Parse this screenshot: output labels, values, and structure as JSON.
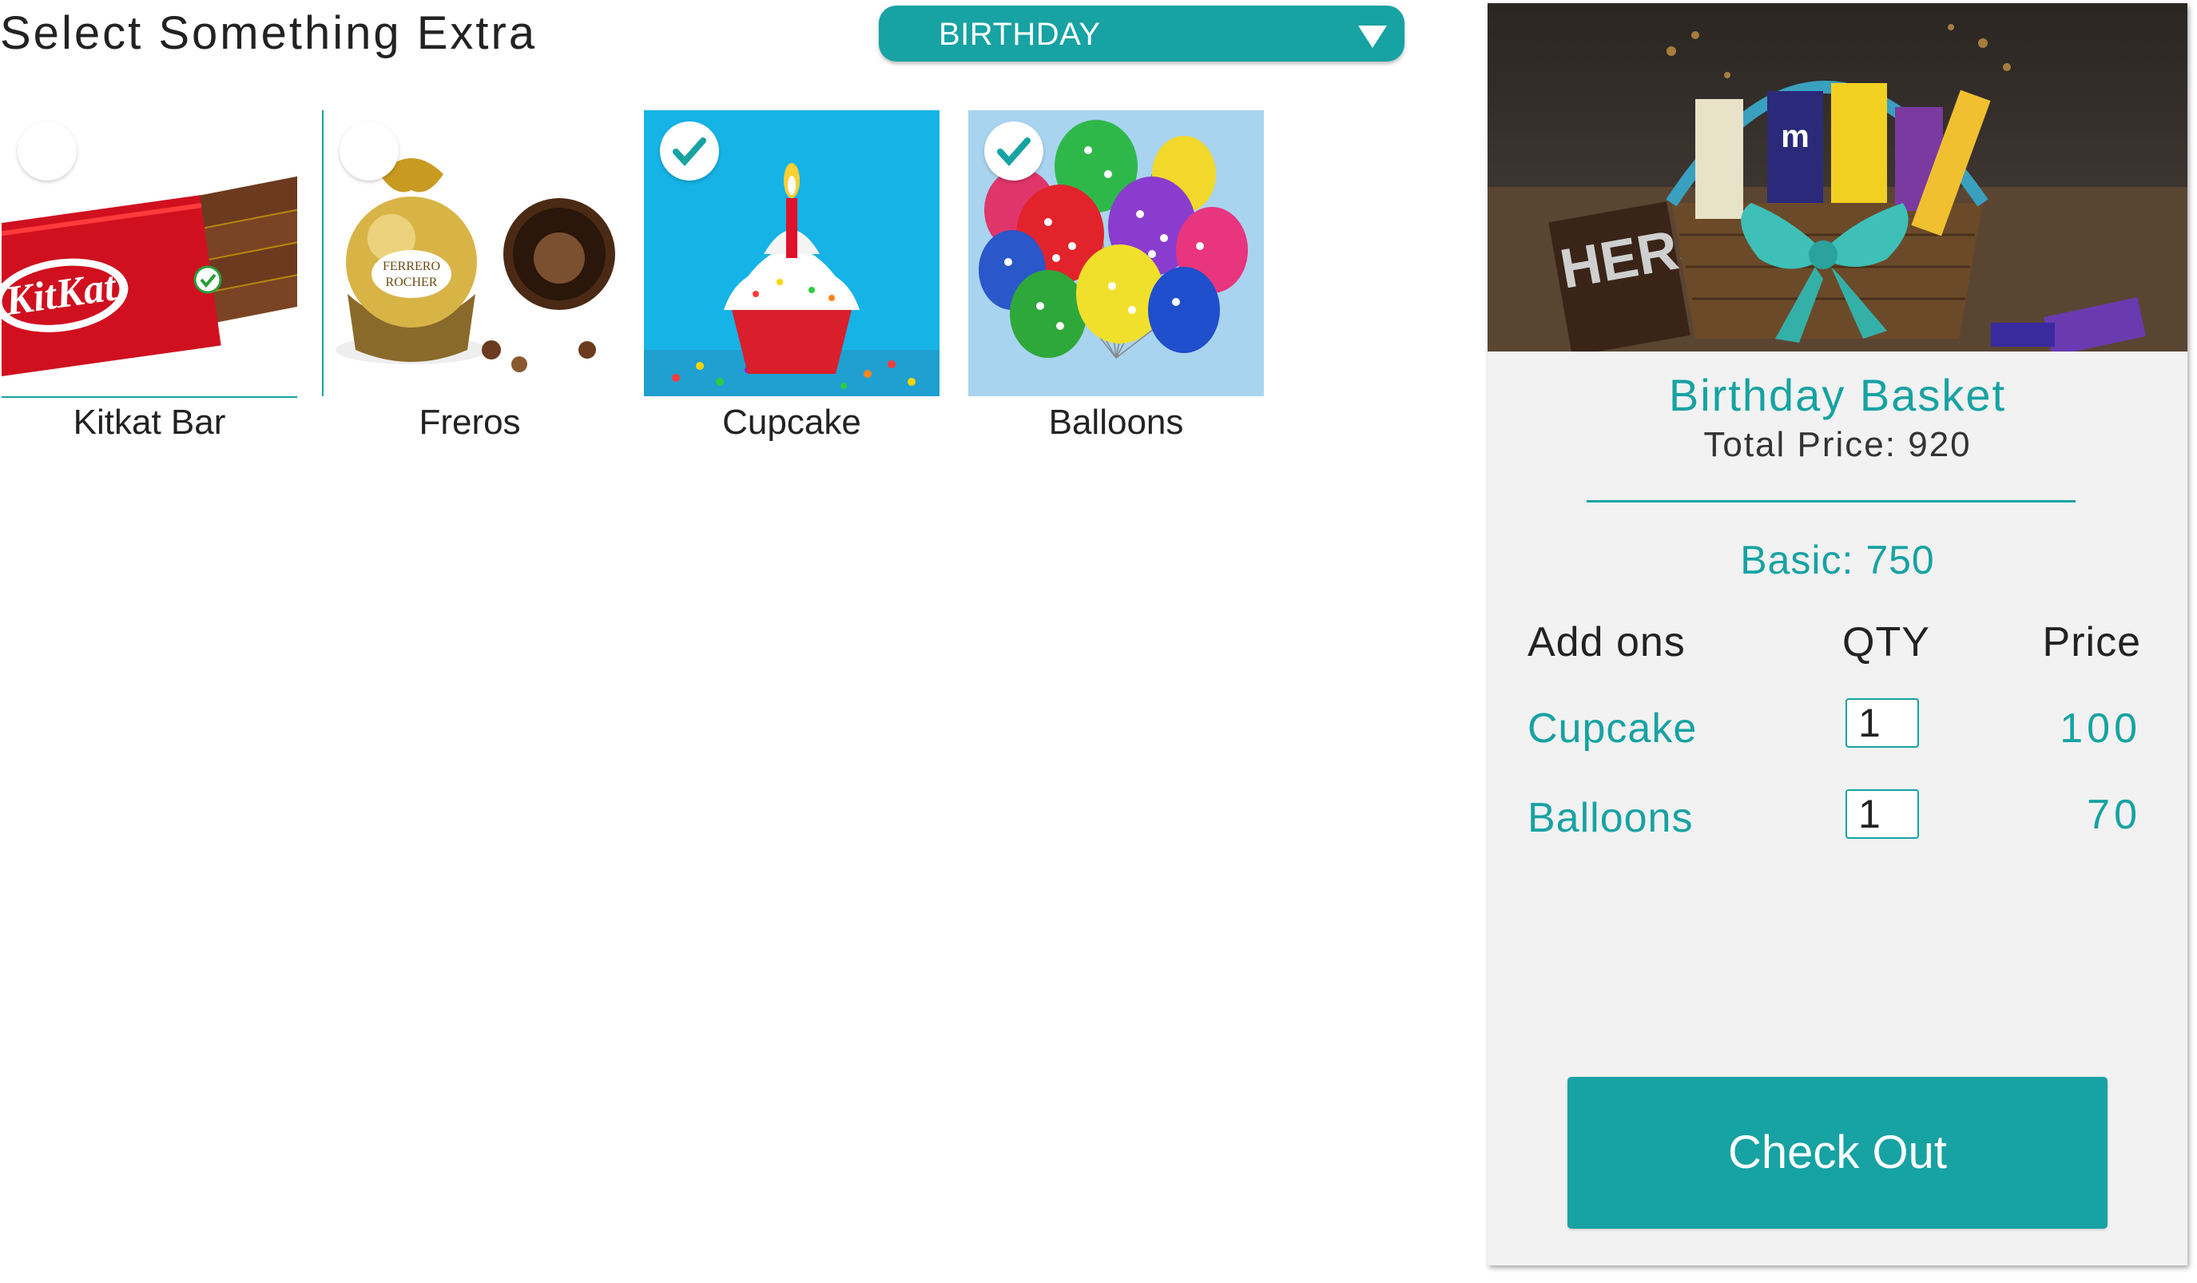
{
  "header": {
    "title": "Select Something Extra",
    "occasion_select": {
      "value": "BIRTHDAY"
    }
  },
  "extras": [
    {
      "name": "Kitkat Bar",
      "selected": false
    },
    {
      "name": "Freros",
      "selected": false
    },
    {
      "name": "Cupcake",
      "selected": true
    },
    {
      "name": "Balloons",
      "selected": true
    }
  ],
  "summary": {
    "basket_name": "Birthday Basket",
    "total_label": "Total Price:",
    "total_value": "920",
    "basic_label": "Basic:",
    "basic_value": "750",
    "columns": {
      "addons": "Add ons",
      "qty": "QTY",
      "price": "Price"
    },
    "addons": [
      {
        "name": "Cupcake",
        "qty": "1",
        "price": "100"
      },
      {
        "name": "Balloons",
        "qty": "1",
        "price": "70"
      }
    ],
    "checkout_label": "Check Out"
  },
  "colors": {
    "accent": "#17a2a3",
    "panel": "#f2f2f2",
    "text": "#222222"
  }
}
